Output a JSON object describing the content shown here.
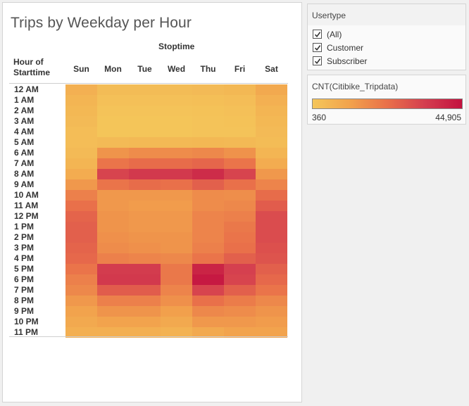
{
  "title": "Trips by Weekday per Hour",
  "column_header_title": "Stoptime",
  "row_header_title": [
    "Hour of",
    "Starttime"
  ],
  "days": [
    "Sun",
    "Mon",
    "Tue",
    "Wed",
    "Thu",
    "Fri",
    "Sat"
  ],
  "hours": [
    "12 AM",
    "1 AM",
    "2 AM",
    "3 AM",
    "4 AM",
    "5 AM",
    "6 AM",
    "7 AM",
    "8 AM",
    "9 AM",
    "10 AM",
    "11 AM",
    "12 PM",
    "1 PM",
    "2 PM",
    "3 PM",
    "4 PM",
    "5 PM",
    "6 PM",
    "7 PM",
    "8 PM",
    "9 PM",
    "10 PM",
    "11 PM"
  ],
  "filter": {
    "title": "Usertype",
    "options": [
      {
        "label": "(All)",
        "checked": true
      },
      {
        "label": "Customer",
        "checked": true
      },
      {
        "label": "Subscriber",
        "checked": true
      }
    ]
  },
  "legend": {
    "title": "CNT(Citibike_Tripdata)",
    "min_label": "360",
    "max_label": "44,905",
    "colors": [
      "#f4c65a",
      "#f2a24c",
      "#e9704a",
      "#d43e4f",
      "#c3123f"
    ]
  },
  "chart_data": {
    "type": "heatmap",
    "title": "Trips by Weekday per Hour",
    "xlabel": "Stoptime",
    "ylabel": "Hour of Starttime",
    "x_categories": [
      "Sun",
      "Mon",
      "Tue",
      "Wed",
      "Thu",
      "Fri",
      "Sat"
    ],
    "y_categories": [
      "12 AM",
      "1 AM",
      "2 AM",
      "3 AM",
      "4 AM",
      "5 AM",
      "6 AM",
      "7 AM",
      "8 AM",
      "9 AM",
      "10 AM",
      "11 AM",
      "12 PM",
      "1 PM",
      "2 PM",
      "3 PM",
      "4 PM",
      "5 PM",
      "6 PM",
      "7 PM",
      "8 PM",
      "9 PM",
      "10 PM",
      "11 PM"
    ],
    "value_range": [
      360,
      44905
    ],
    "values": [
      [
        0.15,
        0.07,
        0.07,
        0.07,
        0.08,
        0.1,
        0.2
      ],
      [
        0.12,
        0.04,
        0.04,
        0.04,
        0.05,
        0.06,
        0.15
      ],
      [
        0.1,
        0.02,
        0.02,
        0.02,
        0.03,
        0.04,
        0.12
      ],
      [
        0.08,
        0.01,
        0.01,
        0.01,
        0.02,
        0.03,
        0.1
      ],
      [
        0.06,
        0.01,
        0.01,
        0.01,
        0.02,
        0.02,
        0.08
      ],
      [
        0.06,
        0.08,
        0.09,
        0.09,
        0.1,
        0.09,
        0.07
      ],
      [
        0.08,
        0.32,
        0.36,
        0.36,
        0.38,
        0.33,
        0.12
      ],
      [
        0.12,
        0.48,
        0.52,
        0.52,
        0.55,
        0.48,
        0.18
      ],
      [
        0.18,
        0.72,
        0.78,
        0.78,
        0.85,
        0.72,
        0.3
      ],
      [
        0.3,
        0.48,
        0.52,
        0.5,
        0.58,
        0.5,
        0.4
      ],
      [
        0.42,
        0.3,
        0.3,
        0.3,
        0.36,
        0.35,
        0.52
      ],
      [
        0.5,
        0.3,
        0.28,
        0.28,
        0.36,
        0.38,
        0.6
      ],
      [
        0.56,
        0.32,
        0.3,
        0.3,
        0.4,
        0.42,
        0.68
      ],
      [
        0.58,
        0.32,
        0.3,
        0.3,
        0.4,
        0.46,
        0.68
      ],
      [
        0.58,
        0.34,
        0.32,
        0.32,
        0.4,
        0.48,
        0.68
      ],
      [
        0.56,
        0.36,
        0.34,
        0.32,
        0.42,
        0.5,
        0.66
      ],
      [
        0.54,
        0.42,
        0.4,
        0.38,
        0.48,
        0.58,
        0.64
      ],
      [
        0.48,
        0.76,
        0.76,
        0.46,
        0.9,
        0.74,
        0.58
      ],
      [
        0.42,
        0.78,
        0.78,
        0.46,
        0.96,
        0.72,
        0.54
      ],
      [
        0.38,
        0.6,
        0.6,
        0.4,
        0.72,
        0.58,
        0.48
      ],
      [
        0.3,
        0.42,
        0.42,
        0.34,
        0.5,
        0.44,
        0.38
      ],
      [
        0.24,
        0.32,
        0.32,
        0.26,
        0.38,
        0.36,
        0.32
      ],
      [
        0.2,
        0.24,
        0.24,
        0.2,
        0.3,
        0.3,
        0.28
      ],
      [
        0.16,
        0.16,
        0.16,
        0.14,
        0.2,
        0.24,
        0.24
      ]
    ],
    "value_note": "normalized 0-1 relative to color scale",
    "grid": false,
    "legend": "right"
  }
}
